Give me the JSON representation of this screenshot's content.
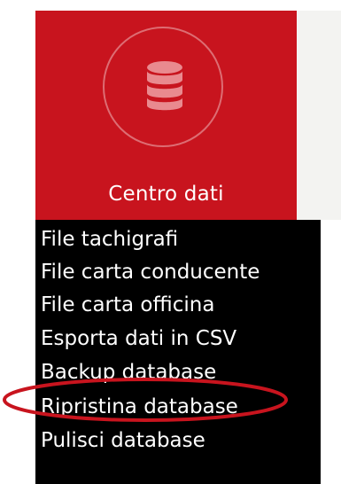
{
  "tile": {
    "label": "Centro dati",
    "icon": "database-icon",
    "color": "#c8141e"
  },
  "menu": {
    "items": [
      {
        "label": "File tachigrafi"
      },
      {
        "label": "File carta conducente"
      },
      {
        "label": "File carta officina"
      },
      {
        "label": "Esporta dati in CSV"
      },
      {
        "label": "Backup database",
        "highlighted": true
      },
      {
        "label": "Ripristina database"
      },
      {
        "label": "Pulisci database"
      }
    ]
  },
  "annotation": {
    "shape": "ellipse",
    "color": "#c8141e",
    "target": "Backup database"
  }
}
